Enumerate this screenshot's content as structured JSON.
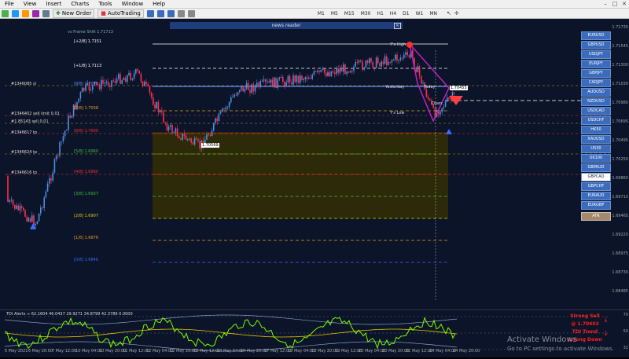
{
  "menu": [
    "File",
    "View",
    "Insert",
    "Charts",
    "Tools",
    "Window",
    "Help"
  ],
  "toolbar": {
    "new_order": "New Order",
    "autotrading": "AutoTrading",
    "timeframes": [
      "M1",
      "M5",
      "M15",
      "M30",
      "H1",
      "H4",
      "D1",
      "W1",
      "MN"
    ]
  },
  "chart": {
    "indicator_name": "vs Frame Shift 1.71713",
    "news_reader": "news reader",
    "levels": [
      {
        "label": "[+2/8]",
        "value": "1.7151"
      },
      {
        "label": "[+1/8]",
        "value": "1.7113"
      },
      {
        "label": "[8/8]",
        "value": "1.7075"
      },
      {
        "label": "[7/8]",
        "value": "1.7038"
      },
      {
        "label": "[6/8]",
        "value": "1.7000"
      },
      {
        "label": "[5/8]",
        "value": "1.6960"
      },
      {
        "label": "[4/8]",
        "value": "1.6960"
      },
      {
        "label": "[3/8]",
        "value": "1.6937"
      },
      {
        "label": "[2/8]",
        "value": "1.6907"
      },
      {
        "label": "[1/8]",
        "value": "1.6876"
      },
      {
        "label": "[0/8]",
        "value": "1.6846"
      }
    ],
    "orders": [
      "#1346085 sl",
      "#1346402 sell limit 0.01",
      "#1.85143 sell 0.01",
      "#1346617 tp",
      "#1346624 tp",
      "#1346616 tp"
    ],
    "y_high": "Y's High",
    "y_low": "Y's Low",
    "yesterday": "Yesterday",
    "today": "Today",
    "open_label": "Open",
    "price_tag": "1.70569",
    "current_price": "1.70455",
    "price_axis": [
      "1.71735",
      "1.71545",
      "1.71300",
      "1.71030",
      "1.70980",
      "1.70695",
      "1.70495",
      "1.70250",
      "1.69860",
      "1.69710",
      "1.69465",
      "1.69220",
      "1.68975",
      "1.68730",
      "1.68485"
    ],
    "pairs": [
      "EURUSD",
      "GBPUSD",
      "USDJPY",
      "EURJPY",
      "GBPJPY",
      "CADJPY",
      "AUDUSD",
      "NZDUSD",
      "USDCAD",
      "USDCHF",
      "HK50",
      "XAUUSD",
      "US30",
      "UK100",
      "GBPAUD",
      "GBPCAD",
      "GBPCHF",
      "EURAUD",
      "EURGBP"
    ],
    "selected_pair": "GBPCAD",
    "atr_label": "ATR"
  },
  "indicator": {
    "label": "TDI Alerts ≈ 62.1604 46.0437 29.9271 34.8799 42.3789 0.0000",
    "levels": [
      "70",
      "50",
      "32"
    ],
    "signal_lines": [
      "Strong Sell",
      "@ 1.70403",
      "TDI Trend",
      "Strong Down"
    ]
  },
  "time_axis": [
    "5 May 2021",
    "6 May 20:00",
    "7 May 12:00",
    "10 May 04:00",
    "10 May 20:00",
    "11 May 12:00",
    "12 May 04:00",
    "12 May 20:00",
    "13 May 12:00",
    "14 May 04:00",
    "14 May 20:00",
    "17 May 12:00",
    "18 May 04:00",
    "18 May 20:00",
    "19 May 12:00",
    "20 May 04:00",
    "20 May 20:00",
    "21 May 12:00",
    "24 May 04:00",
    "24 May 20:00"
  ],
  "watermark": {
    "title": "Activate Windows",
    "subtitle": "Go to PC settings to activate Windows."
  },
  "colors": {
    "bg": "#0b1428",
    "up": "#4a90e2",
    "down": "#ff2f4f",
    "tdi_green": "#7cfc00",
    "tdi_yellow": "#e6c200"
  }
}
